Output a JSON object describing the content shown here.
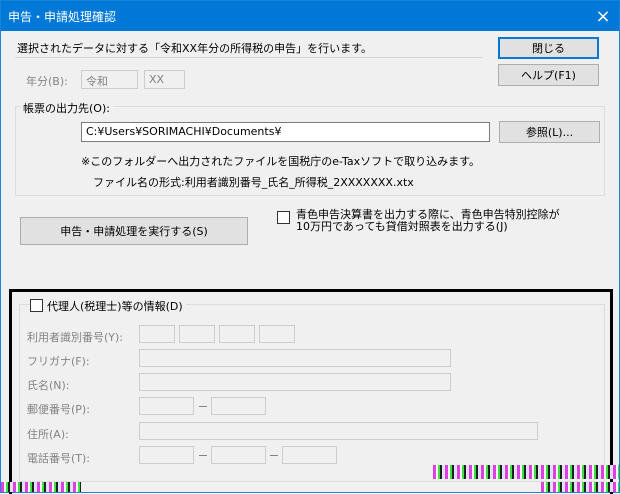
{
  "window": {
    "title": "申告・申請処理確認",
    "close_icon": "×"
  },
  "header": {
    "message": "選択されたデータに対する「令和XX年分の所得税の申告」を行います。"
  },
  "buttons": {
    "close_label": "閉じる",
    "help_label": "ヘルプ(F1)",
    "browse_label": "参照(L)...",
    "execute_label": "申告・申請処理を実行する(S)"
  },
  "year": {
    "label": "年分(B):",
    "era": "令和",
    "value": "XX"
  },
  "output": {
    "legend": "帳票の出力先(O):",
    "path": "C:¥Users¥SORIMACHI¥Documents¥",
    "note": "※このフォルダーへ出力されたファイルを国税庁のe-Taxソフトで取り込みます。",
    "filename_format": "ファイル名の形式:利用者識別番号_氏名_所得税_2XXXXXXX.xtx"
  },
  "balance_option": {
    "label_line1": "青色申告決算書を出力する際に、青色申告特別控除が",
    "label_line2": "10万円であっても貸借対照表を出力する(J)"
  },
  "agent": {
    "legend": "代理人(税理士)等の情報(D)",
    "user_id_label": "利用者識別番号(Y):",
    "furigana_label": "フリガナ(F):",
    "name_label": "氏名(N):",
    "postal_label": "郵便番号(P):",
    "address_label": "住所(A):",
    "phone_label": "電話番号(T):"
  }
}
